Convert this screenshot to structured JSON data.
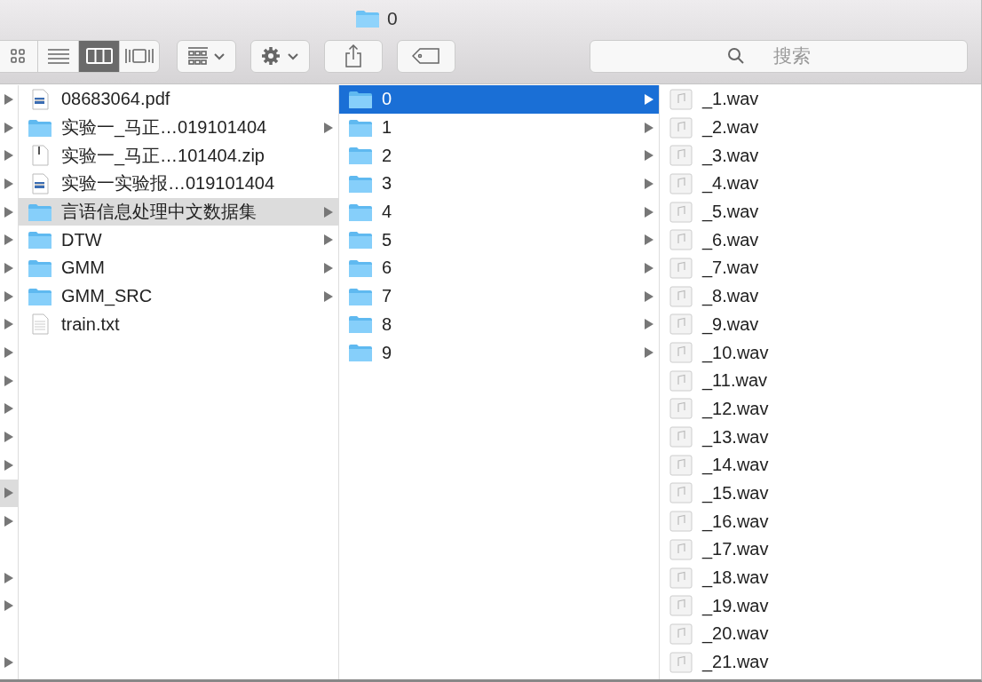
{
  "window": {
    "title": "0"
  },
  "toolbar": {
    "views": [
      {
        "kind": "icons",
        "selected": false
      },
      {
        "kind": "list",
        "selected": false
      },
      {
        "kind": "columns",
        "selected": true
      },
      {
        "kind": "coverflow",
        "selected": false
      }
    ],
    "search": {
      "placeholder": "搜索"
    }
  },
  "columns": [
    {
      "rows": [
        {
          "kind": "folder",
          "selected": false
        },
        {
          "kind": "folder",
          "selected": false
        },
        {
          "kind": "folder",
          "selected": false
        },
        {
          "kind": "folder",
          "selected": false
        },
        {
          "kind": "folder",
          "selected": false
        },
        {
          "kind": "folder",
          "selected": false
        },
        {
          "kind": "folder",
          "selected": false
        },
        {
          "kind": "folder",
          "selected": false
        },
        {
          "kind": "folder",
          "selected": false
        },
        {
          "kind": "folder",
          "selected": false
        },
        {
          "kind": "folder",
          "selected": false
        },
        {
          "kind": "folder",
          "selected": false
        },
        {
          "kind": "folder",
          "selected": false
        },
        {
          "kind": "folder",
          "selected": false
        },
        {
          "kind": "folder",
          "selected": true
        },
        {
          "kind": "folder",
          "selected": false
        },
        {
          "kind": "file",
          "selected": false
        },
        {
          "kind": "folder",
          "selected": false
        },
        {
          "kind": "folder",
          "selected": false
        },
        {
          "kind": "file",
          "selected": false
        },
        {
          "kind": "folder",
          "selected": false
        }
      ]
    },
    {
      "rows": [
        {
          "kind": "pdf",
          "name": "08683064.pdf",
          "selected": false
        },
        {
          "kind": "folder",
          "name": "实验一_马正…019101404",
          "selected": false
        },
        {
          "kind": "zip",
          "name": "实验一_马正…101404.zip",
          "selected": false
        },
        {
          "kind": "pdf",
          "name": "实验一实验报…019101404",
          "selected": false
        },
        {
          "kind": "folder",
          "name": "言语信息处理中文数据集",
          "selected": true
        },
        {
          "kind": "folder",
          "name": "DTW",
          "selected": false
        },
        {
          "kind": "folder",
          "name": "GMM",
          "selected": false
        },
        {
          "kind": "folder",
          "name": "GMM_SRC",
          "selected": false
        },
        {
          "kind": "text",
          "name": "train.txt",
          "selected": false
        }
      ]
    },
    {
      "rows": [
        {
          "kind": "folder",
          "name": "0",
          "selected": true
        },
        {
          "kind": "folder",
          "name": "1",
          "selected": false
        },
        {
          "kind": "folder",
          "name": "2",
          "selected": false
        },
        {
          "kind": "folder",
          "name": "3",
          "selected": false
        },
        {
          "kind": "folder",
          "name": "4",
          "selected": false
        },
        {
          "kind": "folder",
          "name": "5",
          "selected": false
        },
        {
          "kind": "folder",
          "name": "6",
          "selected": false
        },
        {
          "kind": "folder",
          "name": "7",
          "selected": false
        },
        {
          "kind": "folder",
          "name": "8",
          "selected": false
        },
        {
          "kind": "folder",
          "name": "9",
          "selected": false
        }
      ]
    },
    {
      "rows": [
        {
          "kind": "audio",
          "name": "_1.wav",
          "selected": false
        },
        {
          "kind": "audio",
          "name": "_2.wav",
          "selected": false
        },
        {
          "kind": "audio",
          "name": "_3.wav",
          "selected": false
        },
        {
          "kind": "audio",
          "name": "_4.wav",
          "selected": false
        },
        {
          "kind": "audio",
          "name": "_5.wav",
          "selected": false
        },
        {
          "kind": "audio",
          "name": "_6.wav",
          "selected": false
        },
        {
          "kind": "audio",
          "name": "_7.wav",
          "selected": false
        },
        {
          "kind": "audio",
          "name": "_8.wav",
          "selected": false
        },
        {
          "kind": "audio",
          "name": "_9.wav",
          "selected": false
        },
        {
          "kind": "audio",
          "name": "_10.wav",
          "selected": false
        },
        {
          "kind": "audio",
          "name": "_11.wav",
          "selected": false
        },
        {
          "kind": "audio",
          "name": "_12.wav",
          "selected": false
        },
        {
          "kind": "audio",
          "name": "_13.wav",
          "selected": false
        },
        {
          "kind": "audio",
          "name": "_14.wav",
          "selected": false
        },
        {
          "kind": "audio",
          "name": "_15.wav",
          "selected": false
        },
        {
          "kind": "audio",
          "name": "_16.wav",
          "selected": false
        },
        {
          "kind": "audio",
          "name": "_17.wav",
          "selected": false
        },
        {
          "kind": "audio",
          "name": "_18.wav",
          "selected": false
        },
        {
          "kind": "audio",
          "name": "_19.wav",
          "selected": false
        },
        {
          "kind": "audio",
          "name": "_20.wav",
          "selected": false
        },
        {
          "kind": "audio",
          "name": "_21.wav",
          "selected": false
        }
      ]
    }
  ]
}
